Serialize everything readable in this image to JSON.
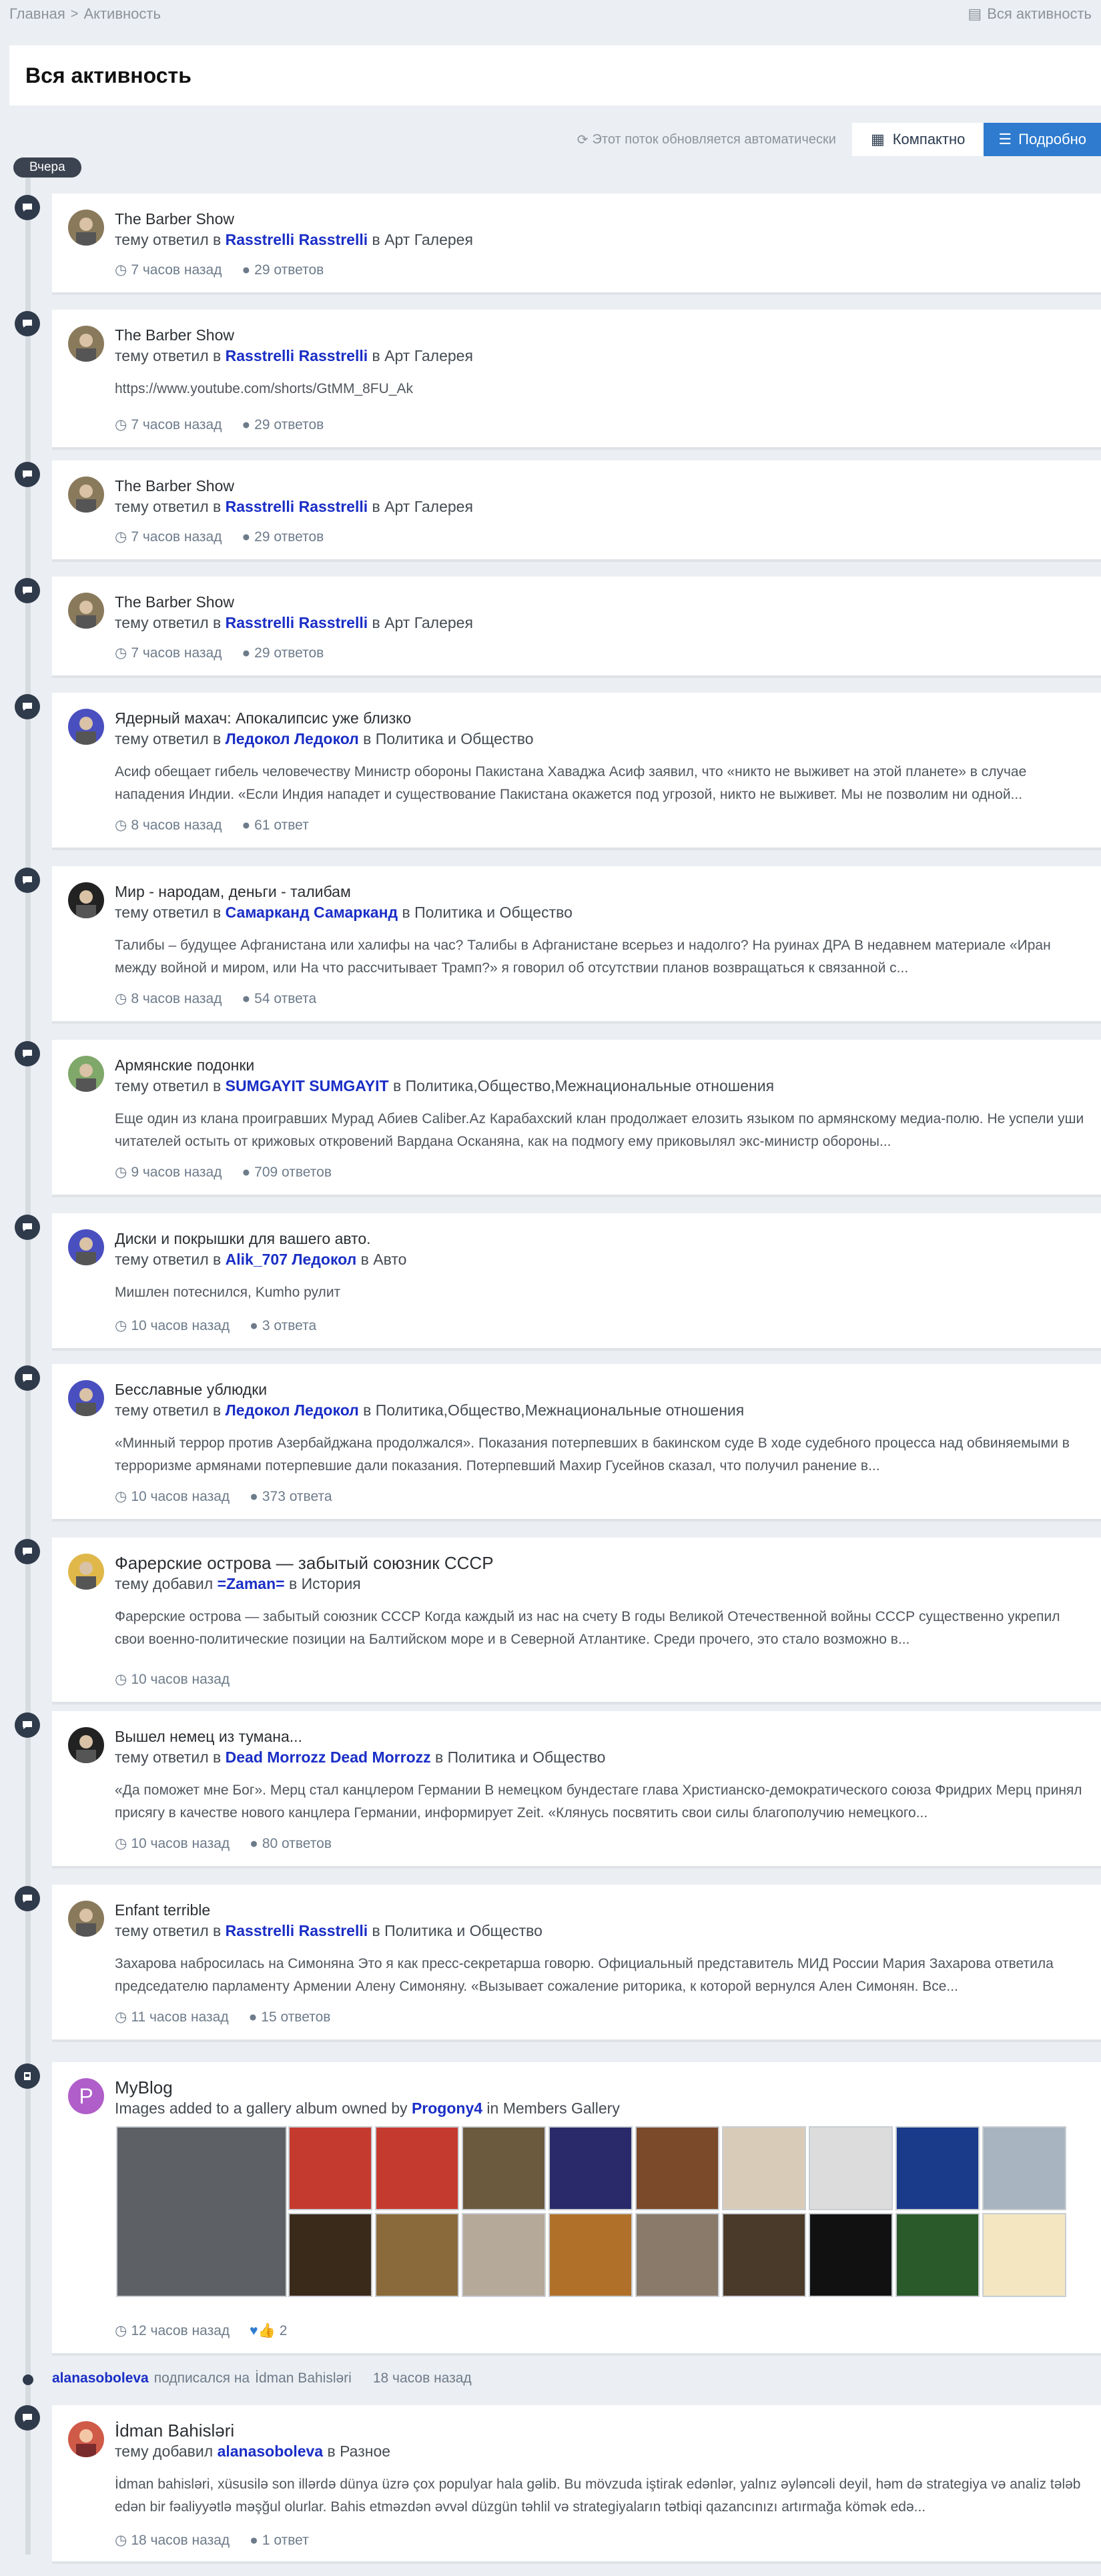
{
  "breadcrumb": {
    "home": "Главная",
    "current": "Активность",
    "right_label": "Вся активность"
  },
  "page_title": "Вся активность",
  "controls": {
    "auto_update": "Этот поток обновляется автоматически",
    "compact": "Компактно",
    "detailed": "Подробно"
  },
  "day_label": "Вчера",
  "items": [
    {
      "title": "The Barber Show",
      "action": "тему ответил в",
      "user": "Rasstrelli Rasstrelli",
      "in": "в",
      "forum": "Арт Галерея",
      "snippet": "",
      "time": "7 часов назад",
      "replies": "29 ответов"
    },
    {
      "title": "The Barber Show",
      "action": "тему ответил в",
      "user": "Rasstrelli Rasstrelli",
      "in": "в",
      "forum": "Арт Галерея",
      "snippet": "https://www.youtube.com/shorts/GtMM_8FU_Ak",
      "time": "7 часов назад",
      "replies": "29 ответов"
    },
    {
      "title": "The Barber Show",
      "action": "тему ответил в",
      "user": "Rasstrelli Rasstrelli",
      "in": "в",
      "forum": "Арт Галерея",
      "snippet": "",
      "time": "7 часов назад",
      "replies": "29 ответов"
    },
    {
      "title": "The Barber Show",
      "action": "тему ответил в",
      "user": "Rasstrelli Rasstrelli",
      "in": "в",
      "forum": "Арт Галерея",
      "snippet": "",
      "time": "7 часов назад",
      "replies": "29 ответов"
    },
    {
      "title": "Ядерный махач: Апокалипсис уже близко",
      "action": "тему ответил в",
      "user": "Ледокол Ледокол",
      "in": "в",
      "forum": "Политика и Общество",
      "snippet": "Асиф обещает гибель человечеству Министр обороны Пакистана Хаваджа Асиф заявил, что «никто не выживет на этой планете» в случае нападения Индии. «Если Индия нападет и существование Пакистана окажется под угрозой, никто не выживет. Мы не позволим ни одной...",
      "time": "8 часов назад",
      "replies": "61 ответ"
    },
    {
      "title": "Мир - народам, деньги - талибам",
      "action": "тему ответил в",
      "user": "Самарканд Самарканд",
      "in": "в",
      "forum": "Политика и Общество",
      "snippet": "Талибы – будущее Афганистана или халифы на час? Талибы в Афганистане всерьез и надолго? На руинах ДРА В недавнем материале «Иран между войной и миром, или На что рассчитывает Трамп?» я говорил об отсутствии планов возвращаться к связанной с...",
      "time": "8 часов назад",
      "replies": "54 ответа"
    },
    {
      "title": "Армянские подонки",
      "action": "тему ответил в",
      "user": "SUMGAYIT SUMGAYIT",
      "in": "в",
      "forum": "Политика,Общество,Межнациональные отношения",
      "snippet": "Еще один из клана проигравших Мурад Абиев Caliber.Az Карабахский клан продолжает елозить языком по армянскому медиа-полю. Не успели уши читателей остыть от крижовых откровений Вардана Осканяна, как на подмогу ему приковылял экс-министр обороны...",
      "time": "9 часов назад",
      "replies": "709 ответов"
    },
    {
      "title": "Диски и покрышки для вашего авто.",
      "action": "тему ответил в",
      "user": "Alik_707 Ледокол",
      "in": "в",
      "forum": "Авто",
      "snippet": "Мишлен потеснился, Kumho рулит",
      "time": "10 часов назад",
      "replies": "3 ответа"
    },
    {
      "title": "Бесславные ублюдки",
      "action": "тему ответил в",
      "user": "Ледокол Ледокол",
      "in": "в",
      "forum": "Политика,Общество,Межнациональные отношения",
      "snippet": "«Минный террор против Азербайджана продолжался». Показания потерпевших в бакинском суде В ходе судебного процесса над обвиняемыми в терроризме армянами потерпевшие дали показания. Потерпевший Махир Гусейнов сказал, что получил ранение в...",
      "time": "10 часов назад",
      "replies": "373 ответа"
    },
    {
      "title": "Фарерские острова — забытый союзник СССР",
      "action": "тему добавил",
      "user": "=Zaman=",
      "in": "в",
      "forum": "История",
      "snippet": "Фарерские острова — забытый союзник СССР Когда каждый из нас на счету В годы Великой Отечественной войны СССР существенно укрепил свои военно-политические позиции на Балтийском море и в Северной Атлантике. Среди прочего, это стало возможно в...",
      "time": "10 часов назад",
      "replies": ""
    },
    {
      "title": "Вышел немец из тумана...",
      "action": "тему ответил в",
      "user": "Dead Morrozz Dead Morrozz",
      "in": "в",
      "forum": "Политика и Общество",
      "snippet": "«Да поможет мне Бог». Мерц стал канцлером Германии В немецком бундестаге глава Христианско-демократического союза Фридрих Мерц принял присягу в качестве нового канцлера Германии, информирует Zeit. «Клянусь посвятить свои силы благополучию немецкого...",
      "time": "10 часов назад",
      "replies": "80 ответов"
    },
    {
      "title": "Enfant terrible",
      "action": "тему ответил в",
      "user": "Rasstrelli Rasstrelli",
      "in": "в",
      "forum": "Политика и Общество",
      "snippet": "Захарова набросилась на Симоняна Это я как пресс-секретарша говорю. Официальный представитель МИД России Мария Захарова ответила председателю парламенту Армении Алену Симоняну. «Вызывает сожаление риторика, к которой вернулся Ален Симонян. Все...",
      "time": "11 часов назад",
      "replies": "15 ответов"
    }
  ],
  "blog": {
    "avatar_letter": "P",
    "title": "MyBlog",
    "prefix": "Images added to a gallery album owned by",
    "user": "Progony4",
    "in": "in",
    "forum": "Members Gallery",
    "time": "12 часов назад",
    "reactions": "2"
  },
  "follow": {
    "user": "alanasoboleva",
    "text": "подписался на",
    "target": "İdman Bahisləri",
    "time": "18 часов назад"
  },
  "last": {
    "title": "İdman Bahisləri",
    "action": "тему добавил",
    "user": "alanasoboleva",
    "in": "в",
    "forum": "Разное",
    "snippet": "İdman bahisləri, xüsusilə son illərdə dünya üzrə çox populyar hala gəlib. Bu mövzuda iştirak edənlər, yalnız əyləncəli deyil, həm də strategiya və analiz tələb edən bir fəaliyyətlə məşğul olurlar. Bahis etməzdən əvvəl düzgün təhlil və strategiyaların tətbiqi qazancınızı artırmağa kömək edə...",
    "time": "18 часов назад",
    "replies": "1 ответ"
  },
  "colors": {
    "accent": "#2e7bcf",
    "user_link": "#1a2ec6",
    "timeline_dot": "#2f3a4b"
  }
}
